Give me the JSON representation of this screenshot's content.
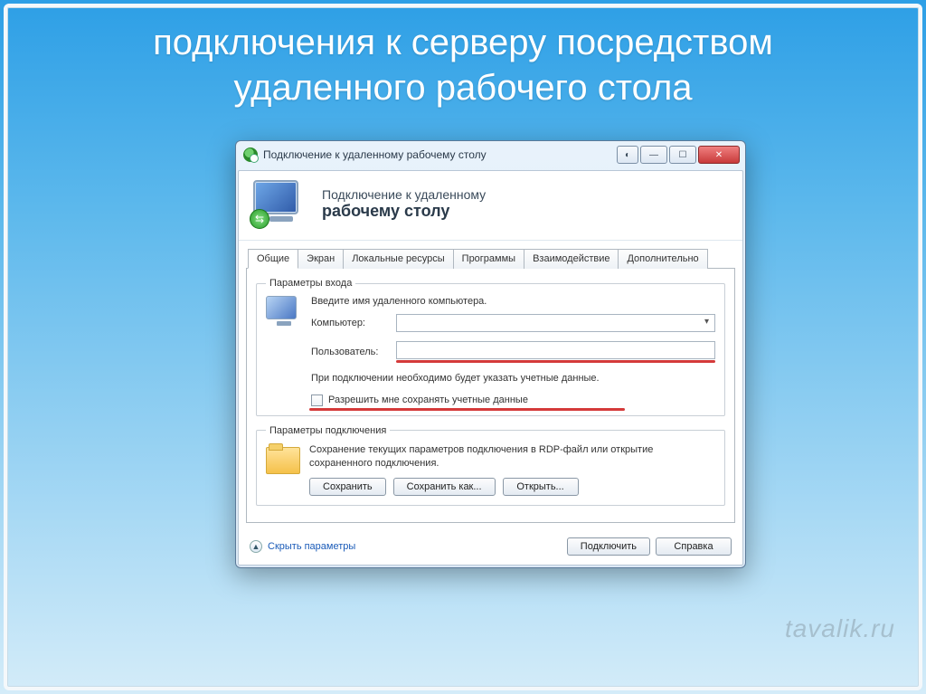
{
  "slide": {
    "title": "подключения к серверу посредством удаленного рабочего стола"
  },
  "window": {
    "title": "Подключение к удаленному рабочему столу"
  },
  "banner": {
    "line1": "Подключение к удаленному",
    "line2": "рабочему столу"
  },
  "tabs": [
    {
      "label": "Общие",
      "active": true
    },
    {
      "label": "Экран",
      "active": false
    },
    {
      "label": "Локальные ресурсы",
      "active": false
    },
    {
      "label": "Программы",
      "active": false
    },
    {
      "label": "Взаимодействие",
      "active": false
    },
    {
      "label": "Дополнительно",
      "active": false
    }
  ],
  "login_group": {
    "legend": "Параметры входа",
    "instruction": "Введите имя удаленного компьютера.",
    "computer_label": "Компьютер:",
    "computer_value": "",
    "user_label": "Пользователь:",
    "user_value": "",
    "note": "При подключении необходимо будет указать учетные данные.",
    "save_creds_label": "Разрешить мне сохранять учетные данные"
  },
  "conn_group": {
    "legend": "Параметры подключения",
    "desc": "Сохранение текущих параметров подключения в RDP-файл или открытие сохраненного подключения.",
    "save": "Сохранить",
    "save_as": "Сохранить как...",
    "open": "Открыть..."
  },
  "footer": {
    "hide_params": "Скрыть параметры",
    "connect": "Подключить",
    "help": "Справка"
  },
  "watermark": "tavalik.ru"
}
